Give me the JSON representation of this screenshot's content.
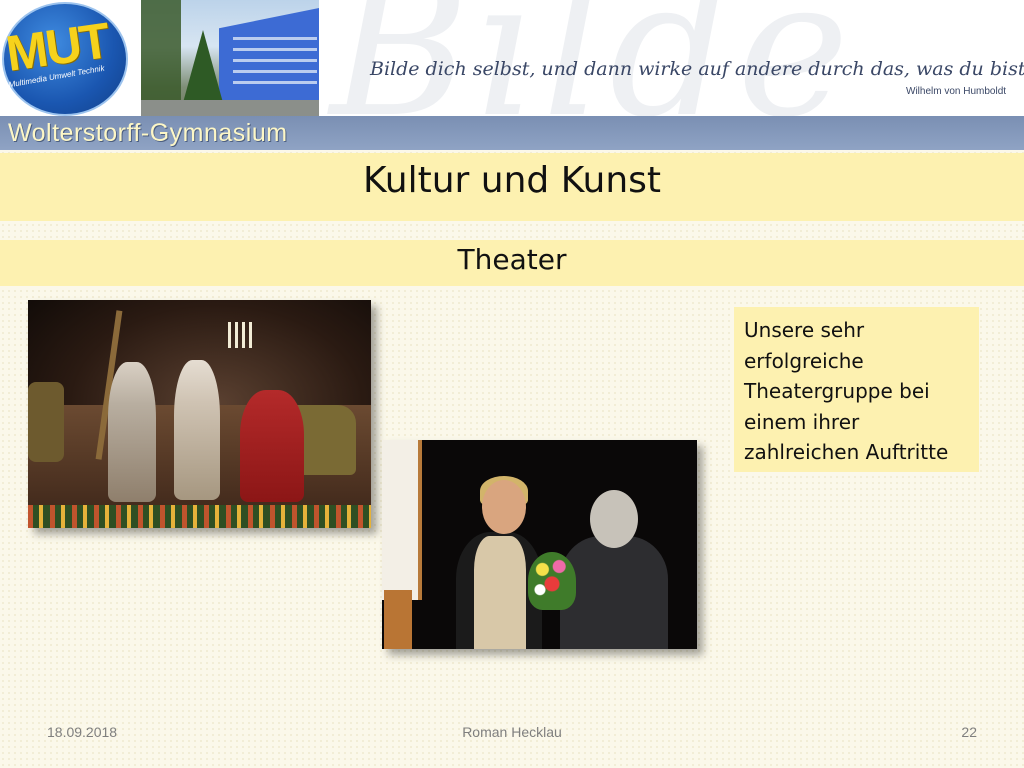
{
  "header": {
    "logo_text": "MUT",
    "logo_subtitle": "Multimedia Umwelt Technik",
    "watermark": "Bilde",
    "quote": "Bilde dich selbst, und dann wirke auf andere durch das, was du bist.",
    "quote_author": "Wilhelm von Humboldt",
    "school_name": "Wolterstorff-Gymnasium",
    "colors": {
      "school_bar": "#8fa3c4",
      "school_name": "#fdf7c6",
      "title_bar": "#fdf1b0"
    }
  },
  "slide": {
    "title": "Kultur und Kunst",
    "subtitle": "Theater",
    "caption_lines": [
      "Unsere sehr",
      "erfolgreiche",
      "Theatergruppe bei",
      "einem ihrer",
      "zahlreichen Auftritte"
    ]
  },
  "footer": {
    "date": "18.09.2018",
    "author": "Roman Hecklau",
    "page": "22"
  }
}
